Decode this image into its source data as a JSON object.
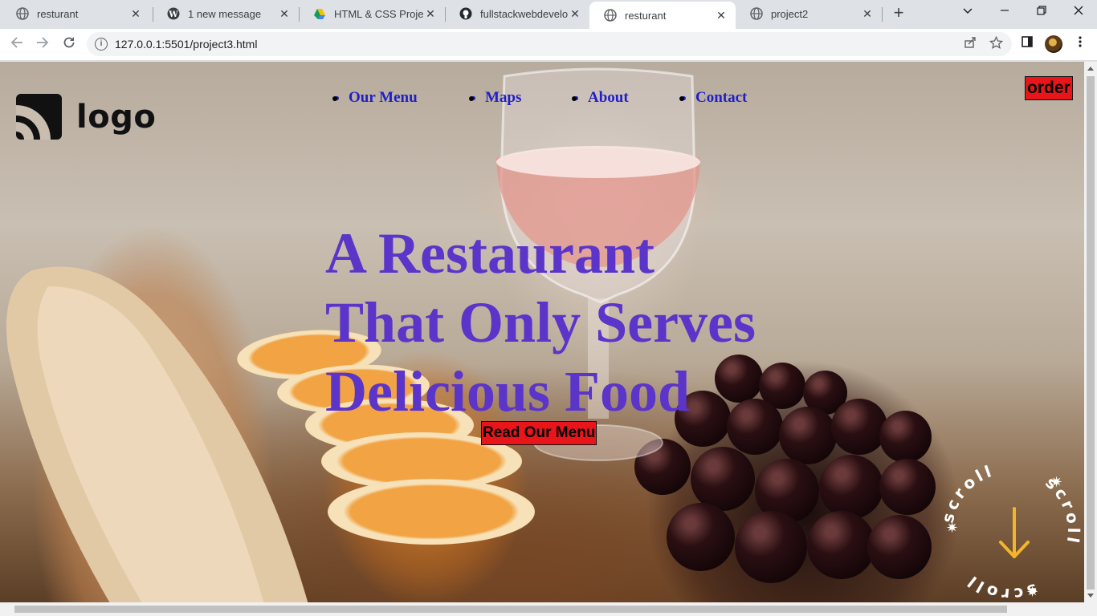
{
  "browser": {
    "tabs": [
      {
        "title": "resturant",
        "icon": "globe-icon"
      },
      {
        "title": "1 new message",
        "icon": "wordpress-icon"
      },
      {
        "title": "HTML & CSS Project",
        "icon": "google-drive-icon"
      },
      {
        "title": "fullstackwebdevelopm",
        "icon": "github-icon"
      },
      {
        "title": "resturant",
        "icon": "globe-icon",
        "active": true
      },
      {
        "title": "project2",
        "icon": "globe-icon"
      }
    ],
    "url": "127.0.0.1:5501/project3.html"
  },
  "site": {
    "logo_text": "logo",
    "nav": [
      "Our Menu",
      "Maps",
      "About",
      "Contact"
    ],
    "order_label": "order",
    "headline": [
      "A Restaurant",
      "That Only Serves",
      "Delicious Food"
    ],
    "cta_label": "Read Our Menu",
    "scroll_text": "scroll",
    "colors": {
      "headline": "#5b34c9",
      "nav_link": "#2020c8",
      "button_bg": "#e8161a",
      "scroll_arrow": "#f5b52a"
    }
  }
}
